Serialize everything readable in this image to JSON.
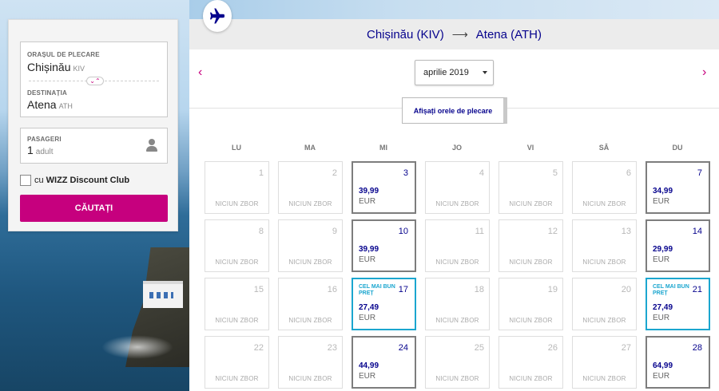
{
  "search": {
    "origin_label": "ORAȘUL DE PLECARE",
    "origin_city": "Chișinău",
    "origin_code": "KIV",
    "destination_label": "DESTINAȚIA",
    "destination_city": "Atena",
    "destination_code": "ATH",
    "passengers_label": "PASAGERI",
    "passengers_count": "1",
    "passengers_unit": "adult",
    "club_prefix": "cu",
    "club_name": "WIZZ Discount Club",
    "search_button": "CĂUTAȚI",
    "swap_glyph": "⌄⌃"
  },
  "header": {
    "from": "Chișinău (KIV)",
    "arrow": "⟶",
    "to": "Atena (ATH)",
    "plane_icon": "plane-icon"
  },
  "calendar": {
    "month": "aprilie 2019",
    "prev_glyph": "‹",
    "next_glyph": "›",
    "times_button": "Afișați orele de plecare",
    "weekdays": [
      "LU",
      "MA",
      "MI",
      "JO",
      "VI",
      "SÂ",
      "DU"
    ],
    "no_flight_text": "NICIUN ZBOR",
    "best_price_text": "CEL MAI BUN PREȚ",
    "currency": "EUR",
    "weeks": [
      [
        {
          "day": "1"
        },
        {
          "day": "2"
        },
        {
          "day": "3",
          "price": "39,99"
        },
        {
          "day": "4"
        },
        {
          "day": "5"
        },
        {
          "day": "6"
        },
        {
          "day": "7",
          "price": "34,99"
        }
      ],
      [
        {
          "day": "8"
        },
        {
          "day": "9"
        },
        {
          "day": "10",
          "price": "39,99"
        },
        {
          "day": "11"
        },
        {
          "day": "12"
        },
        {
          "day": "13"
        },
        {
          "day": "14",
          "price": "29,99"
        }
      ],
      [
        {
          "day": "15"
        },
        {
          "day": "16"
        },
        {
          "day": "17",
          "price": "27,49",
          "best": true
        },
        {
          "day": "18"
        },
        {
          "day": "19"
        },
        {
          "day": "20"
        },
        {
          "day": "21",
          "price": "27,49",
          "best": true
        }
      ],
      [
        {
          "day": "22"
        },
        {
          "day": "23"
        },
        {
          "day": "24",
          "price": "44,99"
        },
        {
          "day": "25"
        },
        {
          "day": "26"
        },
        {
          "day": "27"
        },
        {
          "day": "28",
          "price": "64,99"
        }
      ]
    ]
  },
  "colors": {
    "brand_navy": "#06038d",
    "brand_magenta": "#c6007e",
    "best_price_blue": "#1ba6cf"
  }
}
